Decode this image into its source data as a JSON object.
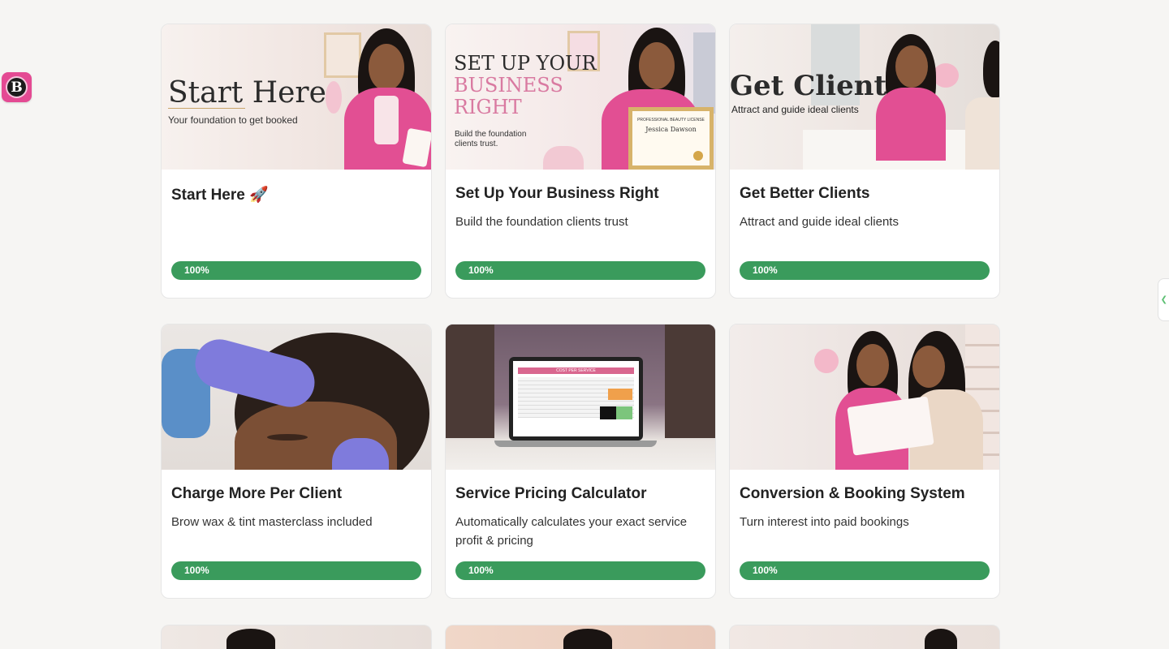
{
  "logo": {
    "letter": "B"
  },
  "cards": [
    {
      "title": "Start Here 🚀",
      "description": "",
      "progress": "100%",
      "progress_value": 1.0,
      "thumb": {
        "heading": "Start Here",
        "sub": "Your foundation to get booked"
      }
    },
    {
      "title": "Set Up Your Business Right",
      "description": "Build the foundation clients trust",
      "progress": "100%",
      "progress_value": 1.0,
      "thumb": {
        "line1": "SET UP YOUR",
        "line2": "BUSINESS",
        "line3": "RIGHT",
        "sub": "Build the foundation clients trust.",
        "cert_title": "PROFESSIONAL BEAUTY LICENSE",
        "cert_name": "Jessica Dawson"
      }
    },
    {
      "title": "Get Better Clients",
      "description": "Attract and guide ideal clients",
      "progress": "100%",
      "progress_value": 1.0,
      "thumb": {
        "heading": "Get Clients",
        "sub": "Attract and guide ideal clients"
      }
    },
    {
      "title": "Charge More Per Client",
      "description": "Brow wax & tint masterclass included",
      "progress": "100%",
      "progress_value": 1.0
    },
    {
      "title": "Service Pricing Calculator",
      "description": "Automatically calculates your exact service profit & pricing",
      "progress": "100%",
      "progress_value": 1.0,
      "thumb": {
        "sheet_title": "COST PER SERVICE"
      }
    },
    {
      "title": "Conversion & Booking System",
      "description": "Turn interest into paid bookings",
      "progress": "100%",
      "progress_value": 1.0
    }
  ],
  "colors": {
    "progress": "#3a9b5c",
    "brand_pink": "#e44a93",
    "background": "#f6f5f3"
  }
}
